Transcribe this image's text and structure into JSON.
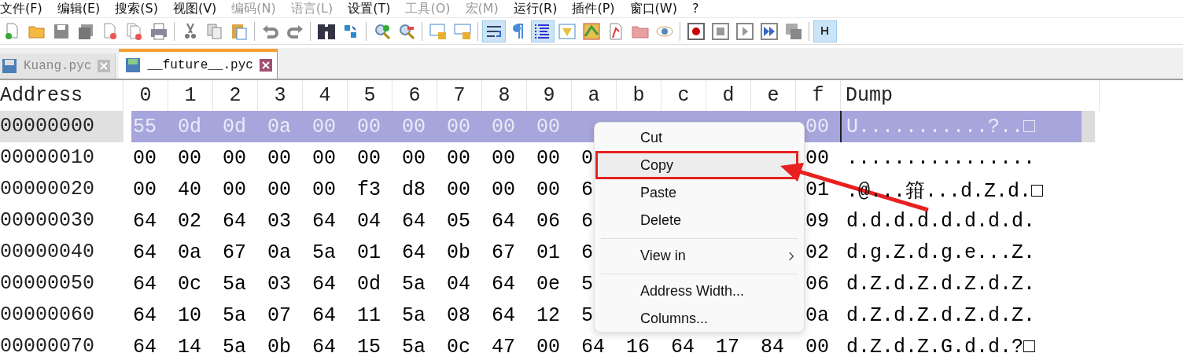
{
  "menu_bar": [
    {
      "label": "文件(F)",
      "disabled": false
    },
    {
      "label": "编辑(E)",
      "disabled": false
    },
    {
      "label": "搜索(S)",
      "disabled": false
    },
    {
      "label": "视图(V)",
      "disabled": false
    },
    {
      "label": "编码(N)",
      "disabled": true
    },
    {
      "label": "语言(L)",
      "disabled": true
    },
    {
      "label": "设置(T)",
      "disabled": false
    },
    {
      "label": "工具(O)",
      "disabled": true
    },
    {
      "label": "宏(M)",
      "disabled": true
    },
    {
      "label": "运行(R)",
      "disabled": false
    },
    {
      "label": "插件(P)",
      "disabled": false
    },
    {
      "label": "窗口(W)",
      "disabled": false
    },
    {
      "label": "?",
      "disabled": false
    }
  ],
  "toolbar": [
    {
      "kind": "new",
      "on": false
    },
    {
      "kind": "open",
      "on": false
    },
    {
      "kind": "save",
      "on": false
    },
    {
      "kind": "saveall",
      "on": false
    },
    {
      "kind": "close",
      "on": false
    },
    {
      "kind": "closeall",
      "on": false
    },
    {
      "kind": "print",
      "on": false
    },
    {
      "kind": "sep"
    },
    {
      "kind": "cut",
      "on": false
    },
    {
      "kind": "copy",
      "on": false
    },
    {
      "kind": "paste",
      "on": false
    },
    {
      "kind": "sep"
    },
    {
      "kind": "undo",
      "on": false
    },
    {
      "kind": "redo",
      "on": false
    },
    {
      "kind": "sep"
    },
    {
      "kind": "find",
      "on": false
    },
    {
      "kind": "replace",
      "on": false
    },
    {
      "kind": "sep"
    },
    {
      "kind": "zoomin",
      "on": false
    },
    {
      "kind": "zoomout",
      "on": false
    },
    {
      "kind": "sep"
    },
    {
      "kind": "syncv",
      "on": false
    },
    {
      "kind": "synch",
      "on": false
    },
    {
      "kind": "sep"
    },
    {
      "kind": "wrap",
      "on": true
    },
    {
      "kind": "pilcrow",
      "on": false
    },
    {
      "kind": "indent",
      "on": true
    },
    {
      "kind": "panel",
      "on": false
    },
    {
      "kind": "map",
      "on": false
    },
    {
      "kind": "func",
      "on": false
    },
    {
      "kind": "folder",
      "on": false
    },
    {
      "kind": "eye",
      "on": false
    },
    {
      "kind": "sep"
    },
    {
      "kind": "record",
      "on": false
    },
    {
      "kind": "stop",
      "on": false
    },
    {
      "kind": "play",
      "on": false
    },
    {
      "kind": "playmulti",
      "on": false
    },
    {
      "kind": "savemacro",
      "on": false
    },
    {
      "kind": "sep"
    },
    {
      "kind": "hex",
      "on": true
    }
  ],
  "tabs": [
    {
      "label": "Kuang.pyc",
      "selected": false
    },
    {
      "label": "__future__.pyc",
      "selected": true
    }
  ],
  "hex_view": {
    "address_header": "Address",
    "column_headers": [
      "0",
      "1",
      "2",
      "3",
      "4",
      "5",
      "6",
      "7",
      "8",
      "9",
      "a",
      "b",
      "c",
      "d",
      "e",
      "f"
    ],
    "dump_header": "Dump",
    "rows": [
      {
        "address": "00000000",
        "selected": true,
        "cells": [
          "55",
          "0d",
          "0d",
          "0a",
          "00",
          "00",
          "00",
          "00",
          "00",
          "00",
          null,
          null,
          null,
          null,
          null,
          "00"
        ],
        "dump": "U...........?..□"
      },
      {
        "address": "00000010",
        "selected": false,
        "cells": [
          "00",
          "00",
          "00",
          "00",
          "00",
          "00",
          "00",
          "00",
          "00",
          "00",
          "0",
          null,
          null,
          null,
          null,
          "00"
        ],
        "dump": "................"
      },
      {
        "address": "00000020",
        "selected": false,
        "cells": [
          "00",
          "40",
          "00",
          "00",
          "00",
          "f3",
          "d8",
          "00",
          "00",
          "00",
          "6",
          null,
          null,
          null,
          null,
          "01"
        ],
        "dump": ".@...箝...d.Z.d.□"
      },
      {
        "address": "00000030",
        "selected": false,
        "cells": [
          "64",
          "02",
          "64",
          "03",
          "64",
          "04",
          "64",
          "05",
          "64",
          "06",
          "6",
          null,
          null,
          null,
          null,
          "09"
        ],
        "dump": "d.d.d.d.d.d.d.d."
      },
      {
        "address": "00000040",
        "selected": false,
        "cells": [
          "64",
          "0a",
          "67",
          "0a",
          "5a",
          "01",
          "64",
          "0b",
          "67",
          "01",
          "6",
          null,
          null,
          null,
          null,
          "02"
        ],
        "dump": "d.g.Z.d.g.e...Z."
      },
      {
        "address": "00000050",
        "selected": false,
        "cells": [
          "64",
          "0c",
          "5a",
          "03",
          "64",
          "0d",
          "5a",
          "04",
          "64",
          "0e",
          "5",
          null,
          null,
          null,
          null,
          "06"
        ],
        "dump": "d.Z.d.Z.d.Z.d.Z."
      },
      {
        "address": "00000060",
        "selected": false,
        "cells": [
          "64",
          "10",
          "5a",
          "07",
          "64",
          "11",
          "5a",
          "08",
          "64",
          "12",
          "5",
          null,
          null,
          null,
          null,
          "0a"
        ],
        "dump": "d.Z.d.Z.d.Z.d.Z."
      },
      {
        "address": "00000070",
        "selected": false,
        "cells": [
          "64",
          "14",
          "5a",
          "0b",
          "64",
          "15",
          "5a",
          "0c",
          "47",
          "00",
          "64",
          "16",
          "64",
          "17",
          "84",
          "00"
        ],
        "dump": "d.Z.d.Z.G.d.d.?□"
      }
    ]
  },
  "context_menu": {
    "items": [
      {
        "kind": "item",
        "label": "Cut",
        "selected": false
      },
      {
        "kind": "item",
        "label": "Copy",
        "selected": true
      },
      {
        "kind": "item",
        "label": "Paste",
        "selected": false
      },
      {
        "kind": "item",
        "label": "Delete",
        "selected": false
      },
      {
        "kind": "separator"
      },
      {
        "kind": "submenu",
        "label": "View in",
        "selected": false
      },
      {
        "kind": "separator"
      },
      {
        "kind": "item",
        "label": "Address Width...",
        "selected": false
      },
      {
        "kind": "item",
        "label": "Columns...",
        "selected": false
      }
    ]
  }
}
